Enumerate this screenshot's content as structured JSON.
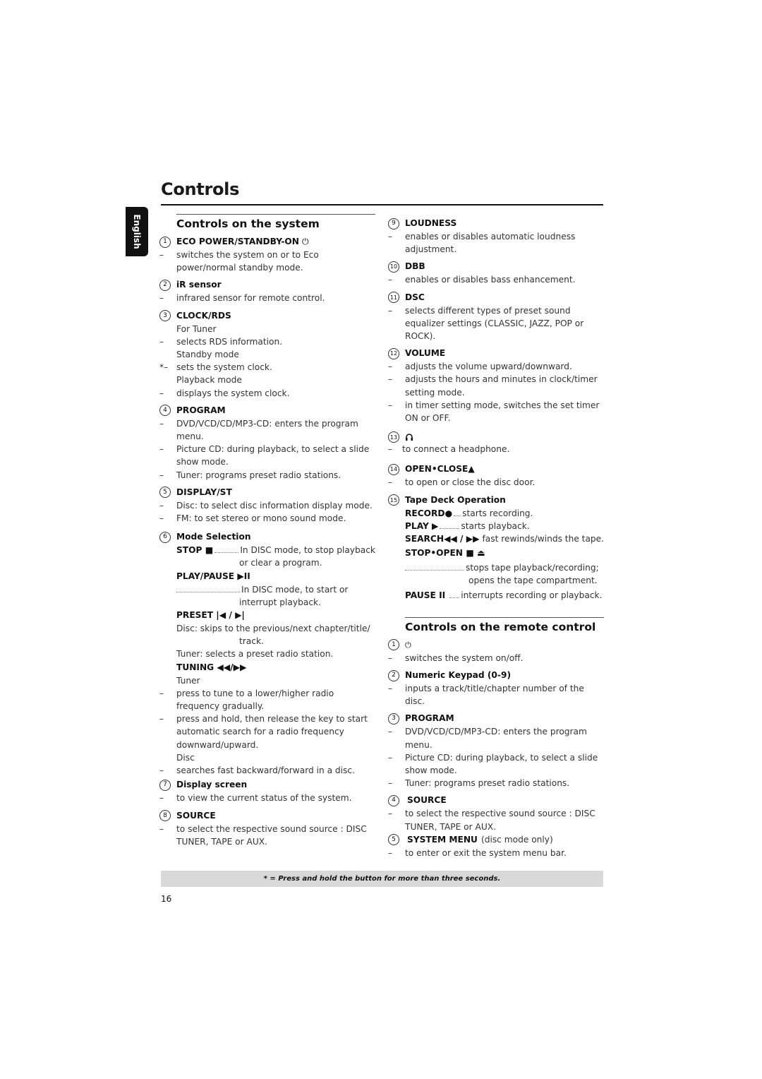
{
  "page": {
    "title": "Controls",
    "language_tab": "English",
    "page_number": "16",
    "footnote": "* = Press and hold the button for more than three seconds."
  },
  "system_section": {
    "title": "Controls on the system",
    "items": [
      {
        "num": "1",
        "label": "ECO POWER/STANDBY-ON",
        "icon": "power-icon",
        "icon_glyph": "⏻",
        "lines": [
          "switches the system on or to Eco power/normal standby mode."
        ]
      },
      {
        "num": "2",
        "label": "iR sensor",
        "lines": [
          "infrared sensor for remote control."
        ]
      },
      {
        "num": "3",
        "label": "CLOCK/RDS",
        "modes": [
          {
            "mode": "For Tuner",
            "prefix": "–",
            "text": "selects RDS information."
          },
          {
            "mode": "Standby mode",
            "prefix": "*–",
            "text": "sets the system clock."
          },
          {
            "mode": "Playback mode",
            "prefix": "–",
            "text": "displays the system clock."
          }
        ]
      },
      {
        "num": "4",
        "label": "PROGRAM",
        "lines": [
          "DVD/VCD/CD/MP3-CD: enters the program menu.",
          "Picture CD: during playback, to select a slide show mode.",
          "Tuner: programs preset radio stations."
        ]
      },
      {
        "num": "5",
        "label": "DISPLAY/ST",
        "lines": [
          "Disc: to select disc information display mode.",
          "FM: to set stereo or mono sound mode."
        ]
      },
      {
        "num": "6",
        "label": "Mode Selection",
        "stop_key": "STOP ■",
        "stop_text": "In DISC mode, to stop playback",
        "stop_text2": "or clear a program.",
        "playpause_key": "PLAY/PAUSE ▶II",
        "playpause_text": "In DISC mode, to start or",
        "playpause_text2": "interrupt playback.",
        "preset_key": "PRESET |◀ / ▶|",
        "preset_text": "Disc: skips to the previous/next chapter/title/",
        "preset_text2": "track.",
        "preset_text3": "Tuner: selects a preset radio station.",
        "tuning_key": "TUNING ◀◀/▶▶",
        "tuning_mode1": "Tuner",
        "tuning_lines": [
          "press to tune to a lower/higher radio frequency gradually.",
          "press and hold, then release the key to start automatic search for a radio frequency downward/upward."
        ],
        "tuning_mode2": "Disc",
        "tuning_disc_line": "searches fast backward/forward in a disc."
      },
      {
        "num": "7",
        "label": "Display screen",
        "lines": [
          "to view the current status of the system."
        ]
      },
      {
        "num": "8",
        "label": "SOURCE",
        "lines": [
          "to select the respective sound source : DISC TUNER, TAPE or AUX."
        ]
      },
      {
        "num": "9",
        "label": "LOUDNESS",
        "lines": [
          "enables or disables automatic loudness adjustment."
        ]
      },
      {
        "num": "10",
        "label": "DBB",
        "lines": [
          "enables or disables bass enhancement."
        ]
      },
      {
        "num": "11",
        "label": "DSC",
        "lines": [
          "selects different types of preset sound equalizer settings (CLASSIC, JAZZ, POP or ROCK)."
        ]
      },
      {
        "num": "12",
        "label": "VOLUME",
        "lines": [
          "adjusts the volume upward/downward.",
          "adjusts the hours and minutes in clock/timer setting mode.",
          "in timer setting mode, switches the set timer ON or OFF."
        ]
      },
      {
        "num": "13",
        "label": "",
        "icon": "headphone-icon",
        "icon_glyph": "∩",
        "lines": [
          "to connect a headphone."
        ]
      },
      {
        "num": "14",
        "label": "OPEN•CLOSE▲",
        "lines": [
          "to open or close the disc door."
        ]
      },
      {
        "num": "15",
        "label": "Tape Deck Operation",
        "record_key": "RECORD●",
        "record_text": "starts recording.",
        "play_key": "PLAY ▶",
        "play_text": "starts playback.",
        "search_key": "SEARCH◀◀ / ▶▶",
        "search_text": "fast rewinds/winds the tape.",
        "stopopen_key": "STOP•OPEN ■ ⏏",
        "stopopen_text": "stops tape playback/recording;",
        "stopopen_text2": "opens the tape compartment.",
        "pause_key": "PAUSE II",
        "pause_text": "interrupts recording or playback."
      }
    ]
  },
  "remote_section": {
    "title": "Controls on the remote control",
    "items": [
      {
        "num": "1",
        "label": "",
        "icon": "power-icon",
        "icon_glyph": "⏻",
        "lines": [
          "switches the system on/off."
        ]
      },
      {
        "num": "2",
        "label": "Numeric Keypad (0-9)",
        "lines": [
          "inputs a track/title/chapter number of the disc."
        ]
      },
      {
        "num": "3",
        "label": "PROGRAM",
        "lines": [
          "DVD/VCD/CD/MP3-CD: enters the program menu.",
          "Picture CD: during playback, to select a slide show mode.",
          "Tuner: programs preset radio stations."
        ]
      },
      {
        "num": "4",
        "label": "SOURCE",
        "lines": [
          "to select the respective sound source : DISC TUNER, TAPE or AUX."
        ]
      },
      {
        "num": "5",
        "label": "SYSTEM MENU",
        "label_suffix": "(disc mode only)",
        "lines": [
          "to enter or exit the system menu bar."
        ]
      }
    ]
  }
}
